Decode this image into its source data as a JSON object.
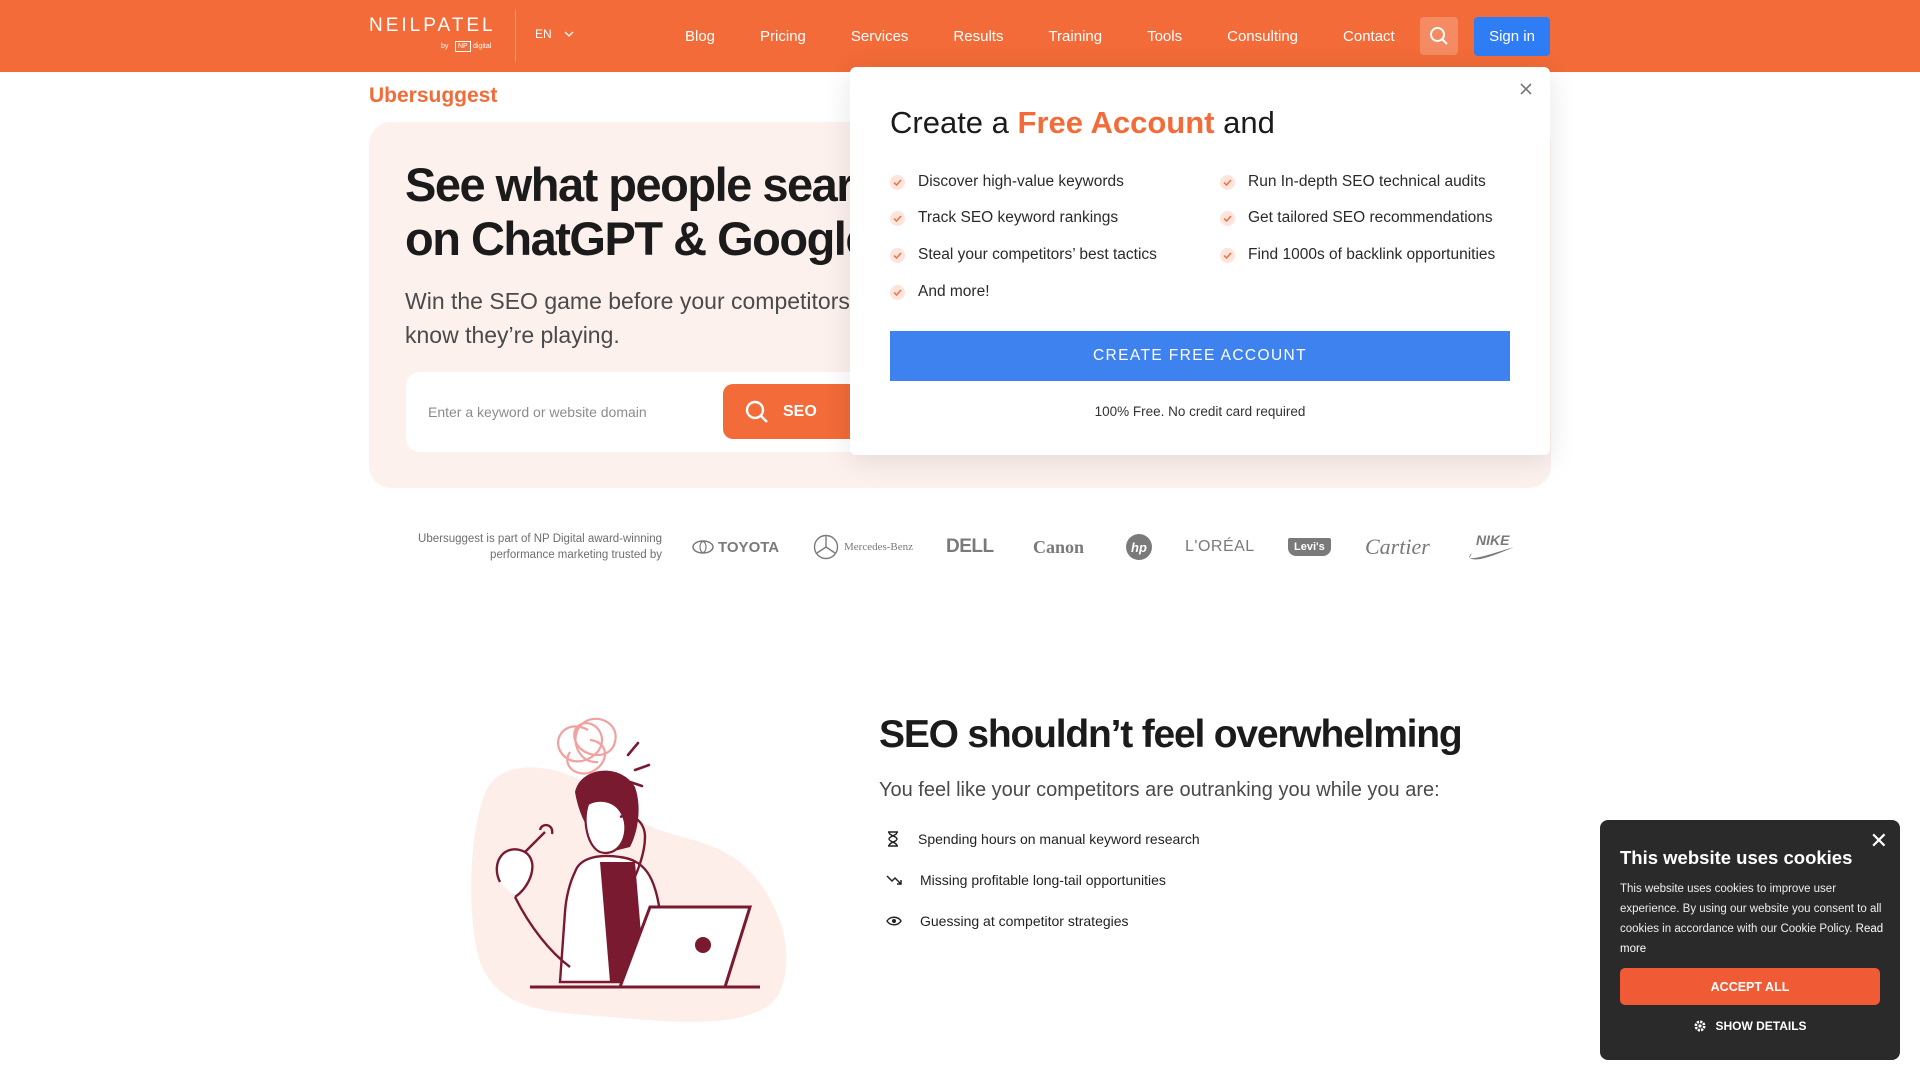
{
  "nav": {
    "logo_word": "NEILPATEL",
    "logo_by": "by",
    "logo_np": "NP",
    "logo_digital": "digital",
    "language": "EN",
    "links": [
      "Blog",
      "Pricing",
      "Services",
      "Results",
      "Training",
      "Tools",
      "Consulting",
      "Contact"
    ],
    "sign_in": "Sign in",
    "accent": "#f26b38",
    "button_blue": "#2f7df5"
  },
  "hero": {
    "brand": "Ubersuggest",
    "title_line1": "See what people search",
    "title_line2": "on ChatGPT & Google",
    "subtitle_line1": "Win the SEO game before your competitors",
    "subtitle_line2": "know they’re playing.",
    "search_placeholder": "Enter a keyword or website domain",
    "search_button": "SEO"
  },
  "trusted": {
    "text": "Ubersuggest is part of NP Digital award-winning performance marketing trusted by",
    "brands": [
      "TOYOTA",
      "Mercedes-Benz",
      "DELL",
      "Canon",
      "hp",
      "L'ORÉAL",
      "Levi's",
      "Cartier",
      "NIKE"
    ]
  },
  "section2": {
    "title": "SEO shouldn’t feel overwhelming",
    "subtitle": "You feel like your competitors are outranking you while you are:",
    "items": [
      {
        "icon": "hourglass-icon",
        "text": "Spending hours on manual keyword research"
      },
      {
        "icon": "trend-down-icon",
        "text": "Missing profitable long-tail opportunities"
      },
      {
        "icon": "eye-icon",
        "text": "Guessing at competitor strategies"
      }
    ]
  },
  "modal": {
    "title_pre": "Create a",
    "title_highlight": "Free Account",
    "title_post": "and",
    "features_left": [
      "Discover high-value keywords",
      "Track SEO keyword rankings",
      "Steal your competitors’ best tactics",
      "And more!"
    ],
    "features_right": [
      "Run In-depth SEO technical audits",
      "Get tailored SEO recommendations",
      "Find 1000s of backlink opportunities"
    ],
    "cta": "CREATE FREE ACCOUNT",
    "note": "100% Free. No credit card required"
  },
  "cookie": {
    "title": "This website uses cookies",
    "body": "This website uses cookies to improve user experience. By using our website you consent to all cookies in accordance with our Cookie Policy.",
    "read_more": "Read more",
    "accept": "ACCEPT ALL",
    "details": "SHOW DETAILS"
  }
}
